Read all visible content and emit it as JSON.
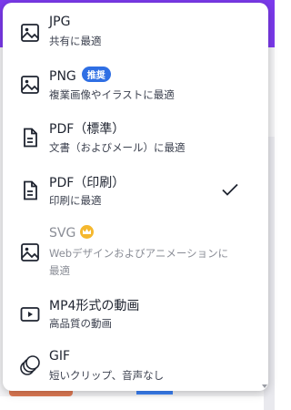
{
  "menu": {
    "items": [
      {
        "title": "JPG",
        "subtitle": "共有に最適",
        "icon": "image-icon"
      },
      {
        "title": "PNG",
        "badge": "推奨",
        "subtitle": "複業画像やイラストに最適",
        "icon": "image-icon"
      },
      {
        "title": "PDF（標準）",
        "subtitle": "文書（およびメール）に最適",
        "icon": "document-icon"
      },
      {
        "title": "PDF（印刷）",
        "subtitle": "印刷に最適",
        "icon": "document-icon",
        "selected": true
      },
      {
        "title": "SVG",
        "subtitle_line1": "Webデザインおよびアニメーションに",
        "subtitle_line2": "最適",
        "icon": "image-icon",
        "disabled": true,
        "premium": true
      },
      {
        "title": "MP4形式の動画",
        "subtitle": "高品質の動画",
        "icon": "video-icon"
      },
      {
        "title": "GIF",
        "subtitle": "短いクリップ、音声なし",
        "icon": "gif-icon"
      }
    ]
  },
  "colors": {
    "accent": "#2f6fe4",
    "crown": "#f5b82e",
    "header_bg": "#7c3aed"
  }
}
